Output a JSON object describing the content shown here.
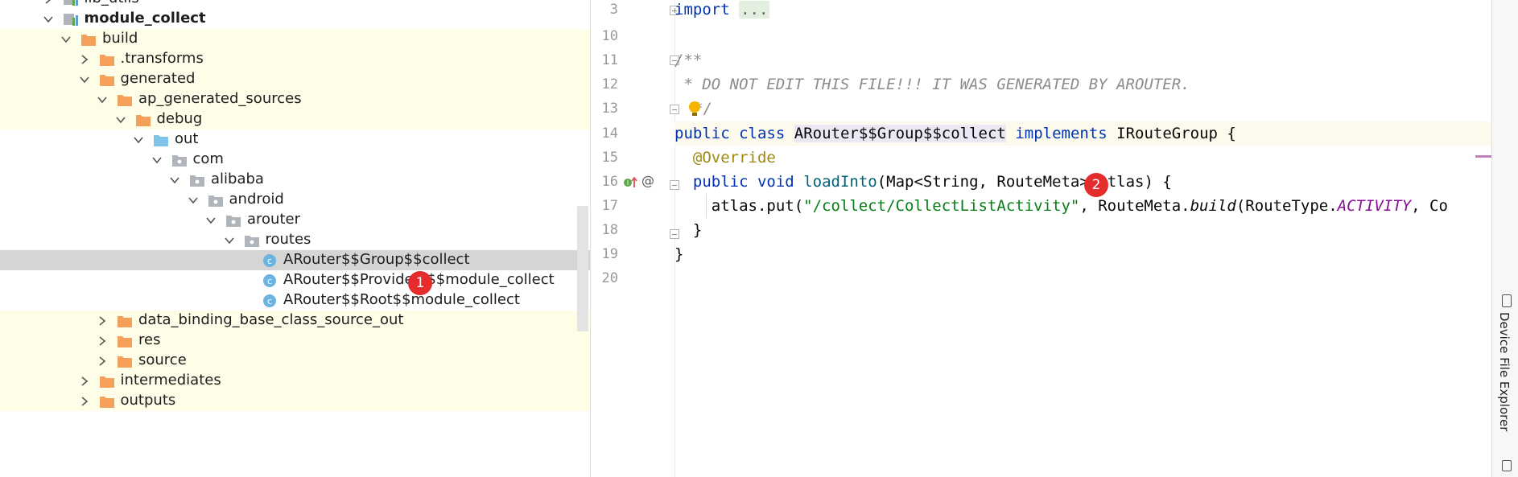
{
  "tree": {
    "items": [
      {
        "label": "lib_utils",
        "depth": 1,
        "icon": "module",
        "expanded": false,
        "bg": "none"
      },
      {
        "label": "module_collect",
        "depth": 1,
        "icon": "module",
        "expanded": true,
        "bold": true,
        "bg": "none"
      },
      {
        "label": "build",
        "depth": 2,
        "icon": "folder-orange",
        "expanded": true,
        "bg": "yellow"
      },
      {
        "label": ".transforms",
        "depth": 3,
        "icon": "folder-orange",
        "expanded": false,
        "bg": "yellow"
      },
      {
        "label": "generated",
        "depth": 3,
        "icon": "folder-orange",
        "expanded": true,
        "bg": "yellow"
      },
      {
        "label": "ap_generated_sources",
        "depth": 4,
        "icon": "folder-orange",
        "expanded": true,
        "bg": "yellow"
      },
      {
        "label": "debug",
        "depth": 5,
        "icon": "folder-orange",
        "expanded": true,
        "bg": "yellow"
      },
      {
        "label": "out",
        "depth": 6,
        "icon": "folder-blue",
        "expanded": true,
        "bg": "none"
      },
      {
        "label": "com",
        "depth": 7,
        "icon": "package",
        "expanded": true,
        "bg": "none"
      },
      {
        "label": "alibaba",
        "depth": 8,
        "icon": "package",
        "expanded": true,
        "bg": "none"
      },
      {
        "label": "android",
        "depth": 9,
        "icon": "package",
        "expanded": true,
        "bg": "none"
      },
      {
        "label": "arouter",
        "depth": 10,
        "icon": "package",
        "expanded": true,
        "bg": "none"
      },
      {
        "label": "routes",
        "depth": 11,
        "icon": "package",
        "expanded": true,
        "bg": "none"
      },
      {
        "label": "ARouter$$Group$$collect",
        "depth": 12,
        "icon": "class",
        "bg": "selected"
      },
      {
        "label": "ARouter$$Providers$$module_collect",
        "depth": 12,
        "icon": "class",
        "bg": "none"
      },
      {
        "label": "ARouter$$Root$$module_collect",
        "depth": 12,
        "icon": "class",
        "bg": "none"
      },
      {
        "label": "data_binding_base_class_source_out",
        "depth": 4,
        "icon": "folder-orange",
        "expanded": false,
        "bg": "yellow"
      },
      {
        "label": "res",
        "depth": 4,
        "icon": "folder-orange",
        "expanded": false,
        "bg": "yellow"
      },
      {
        "label": "source",
        "depth": 4,
        "icon": "folder-orange",
        "expanded": false,
        "bg": "yellow"
      },
      {
        "label": "intermediates",
        "depth": 3,
        "icon": "folder-orange",
        "expanded": false,
        "bg": "yellow"
      },
      {
        "label": "outputs",
        "depth": 3,
        "icon": "folder-orange",
        "expanded": false,
        "bg": "yellow"
      }
    ]
  },
  "badges": {
    "one": "1",
    "two": "2"
  },
  "editor": {
    "line_numbers": [
      "3",
      "10",
      "11",
      "12",
      "13",
      "14",
      "15",
      "16",
      "17",
      "18",
      "19",
      "20"
    ],
    "code": {
      "l3_kw": "import",
      "l3_collapsed": "...",
      "l11": "/**",
      "l12": " * DO NOT EDIT THIS FILE!!! IT WAS GENERATED BY AROUTER.",
      "l13": "*/",
      "l14_kw1": "public",
      "l14_kw2": "class",
      "l14_cls": "ARouter$$Group$$collect",
      "l14_kw3": "implements",
      "l14_rest": "IRouteGroup {",
      "l15": "@Override",
      "l16_kw1": "public",
      "l16_kw2": "void",
      "l16_fn": "loadInto",
      "l16_a": "(Map<String, RouteMeta",
      "l16_b": "> atlas) {",
      "l17_a": "atlas.put(",
      "l17_str": "\"/collect/CollectListActivity\"",
      "l17_b": ", RouteMeta.",
      "l17_fn": "build",
      "l17_c": "(RouteType.",
      "l17_const": "ACTIVITY",
      "l17_d": ", Co",
      "l18": "}",
      "l19": "}"
    },
    "gutter": {
      "at_symbol": "@"
    }
  },
  "rightbar": {
    "device_file_explorer": "Device File Explorer"
  },
  "colors": {
    "selected_row": "#d5d5d5",
    "ignored_bg": "#fefde8",
    "badge": "#e52c2c",
    "keyword": "#0033b3"
  }
}
